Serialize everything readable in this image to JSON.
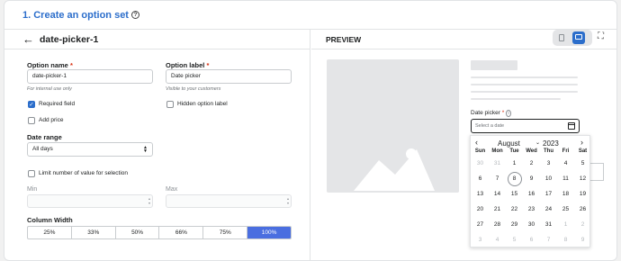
{
  "header": {
    "title": "1. Create an option set",
    "help_glyph": "?"
  },
  "editor": {
    "back_glyph": "←",
    "page_title": "date-picker-1",
    "option_name": {
      "label": "Option name",
      "required": "*",
      "value": "date-picker-1",
      "hint": "For internal use only"
    },
    "option_label": {
      "label": "Option label",
      "required": "*",
      "value": "Date picker",
      "hint": "Visible to your customers"
    },
    "required_field": {
      "label": "Required field",
      "checked": true
    },
    "hidden_label": {
      "label": "Hidden option label",
      "checked": false
    },
    "add_price": {
      "label": "Add price",
      "checked": false
    },
    "date_range": {
      "label": "Date range",
      "value": "All days"
    },
    "limit": {
      "label": "Limit number of value for selection",
      "checked": false
    },
    "min_label": "Min",
    "max_label": "Max",
    "column_width": {
      "label": "Column Width",
      "options": [
        "25%",
        "33%",
        "50%",
        "66%",
        "75%",
        "100%"
      ],
      "selected": "100%"
    }
  },
  "preview": {
    "label": "PREVIEW",
    "field_label": "Date picker",
    "required": "*",
    "info_glyph": "i",
    "placeholder": "Select a date",
    "calendar": {
      "prev": "‹",
      "next": "›",
      "month": "August",
      "year": "2023",
      "weekdays": [
        "Sun",
        "Mon",
        "Tue",
        "Wed",
        "Thu",
        "Fri",
        "Sat"
      ],
      "weeks": [
        [
          "30",
          "31",
          "1",
          "2",
          "3",
          "4",
          "5"
        ],
        [
          "6",
          "7",
          "8",
          "9",
          "10",
          "11",
          "12"
        ],
        [
          "13",
          "14",
          "15",
          "16",
          "17",
          "18",
          "19"
        ],
        [
          "20",
          "21",
          "22",
          "23",
          "24",
          "25",
          "26"
        ],
        [
          "27",
          "28",
          "29",
          "30",
          "31",
          "1",
          "2"
        ],
        [
          "3",
          "4",
          "5",
          "6",
          "7",
          "8",
          "9"
        ]
      ],
      "selected_day": "8"
    }
  }
}
